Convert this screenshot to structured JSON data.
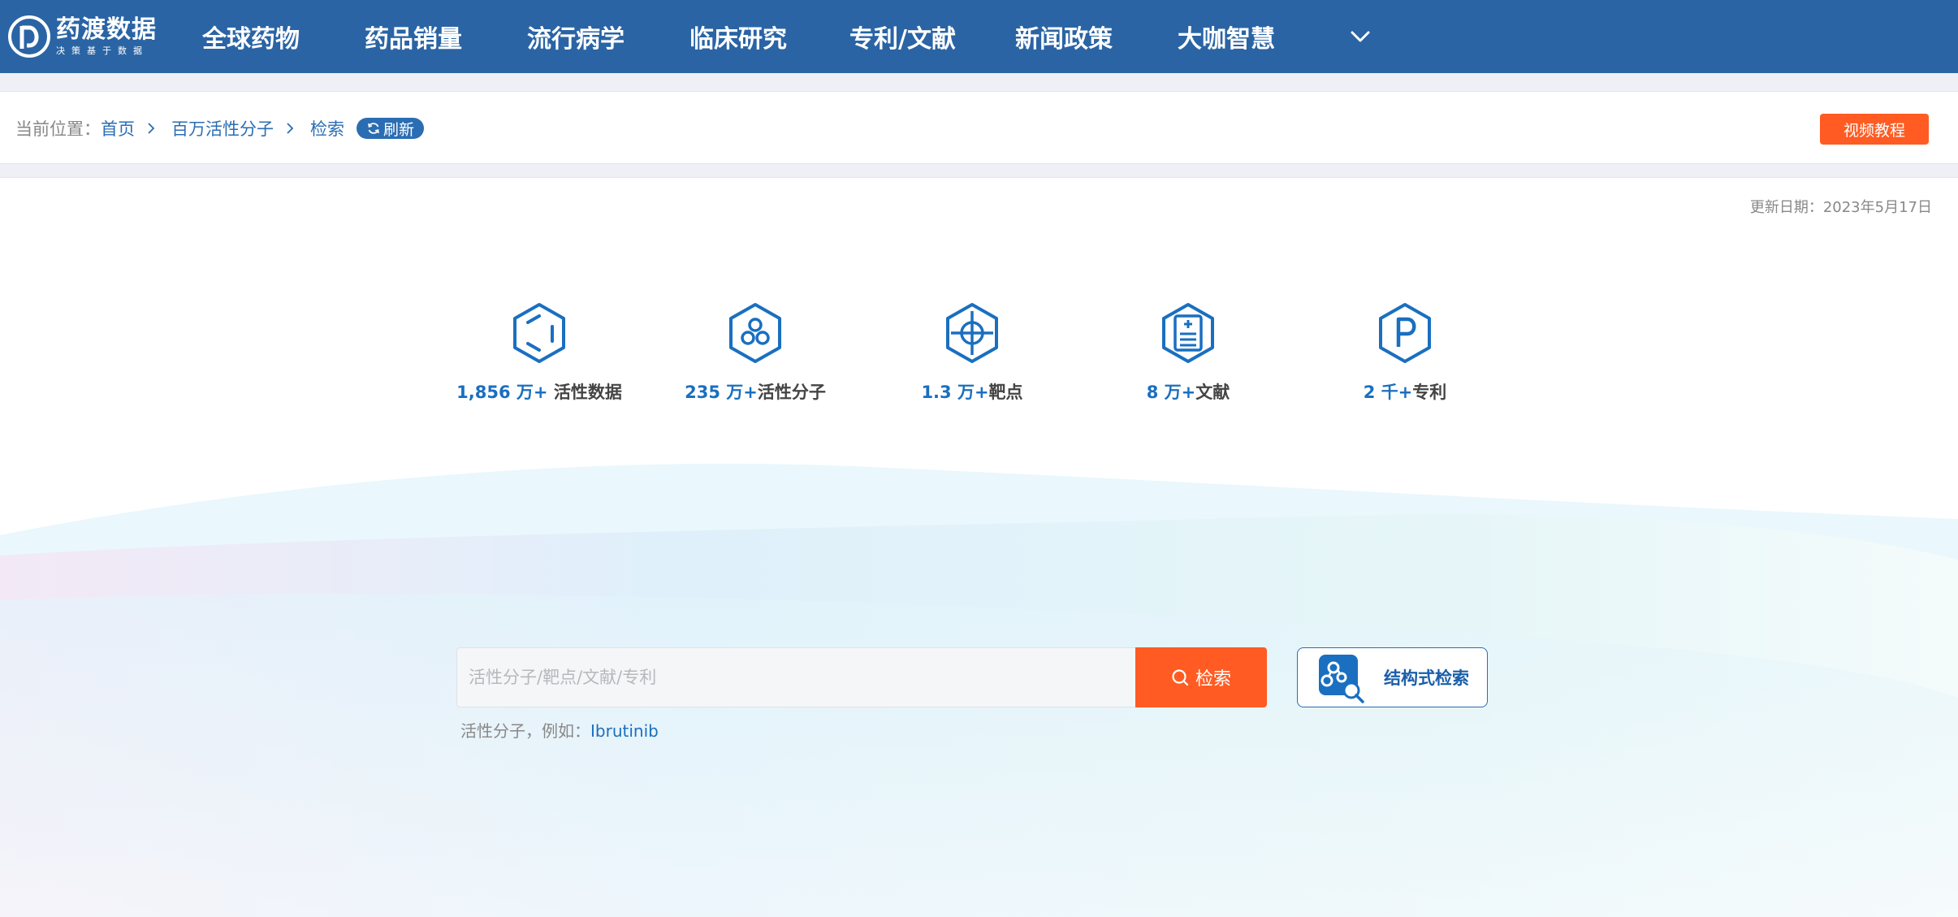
{
  "brand": {
    "name": "药渡数据",
    "slogan": "决策基于数据"
  },
  "nav": {
    "items": [
      {
        "label": "全球药物"
      },
      {
        "label": "药品销量"
      },
      {
        "label": "流行病学"
      },
      {
        "label": "临床研究"
      },
      {
        "label": "专利/文献"
      },
      {
        "label": "新闻政策"
      },
      {
        "label": "大咖智慧"
      }
    ],
    "more_icon": "chevron-down-icon"
  },
  "breadcrumb": {
    "prefix": "当前位置：",
    "items": [
      "首页",
      "百万活性分子",
      "检索"
    ],
    "refresh_label": "刷新",
    "video_label": "视频教程"
  },
  "main": {
    "update_date": "更新日期：2023年5月17日",
    "stats": [
      {
        "number": "1,856 万+",
        "label": " 活性数据",
        "icon": "hexagon-ring-icon"
      },
      {
        "number": "235 万+",
        "label": "活性分子",
        "icon": "molecule-icon"
      },
      {
        "number": "1.3 万+",
        "label": "靶点",
        "icon": "target-icon"
      },
      {
        "number": "8 万+",
        "label": "文献",
        "icon": "document-icon"
      },
      {
        "number": "2 千+",
        "label": "专利",
        "icon": "patent-icon"
      }
    ],
    "search": {
      "placeholder": "活性分子/靶点/文献/专利",
      "value": "",
      "button_label": "检索",
      "hint_prefix": "活性分子，例如：",
      "hint_example": "Ibrutinib"
    },
    "structure_search_label": "结构式检索"
  },
  "colors": {
    "nav_bg": "#2a64a4",
    "accent_blue": "#1a6fc0",
    "accent_orange": "#ff5b22"
  }
}
